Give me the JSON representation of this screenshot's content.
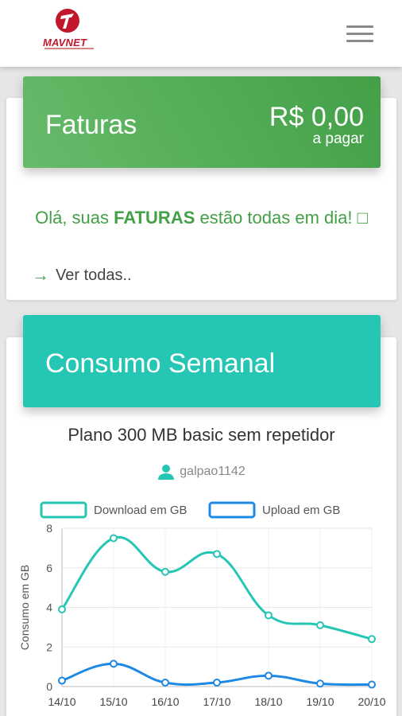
{
  "header": {
    "brand": "MAVNET",
    "menu_icon": "hamburger-menu-icon"
  },
  "invoices": {
    "title": "Faturas",
    "amount": "R$ 0,00",
    "amount_caption": "a pagar",
    "message_prefix": "Olá, suas ",
    "message_strong": "FATURAS",
    "message_suffix": " estão todas em dia! □",
    "view_all": "Ver todas..",
    "accent": "#43a047"
  },
  "usage": {
    "title": "Consumo Semanal",
    "plan": "Plano 300 MB basic sem repetidor",
    "username": "galpao1142",
    "accent": "#26c6b4"
  },
  "chart_data": {
    "type": "line",
    "categories": [
      "14/10",
      "15/10",
      "16/10",
      "17/10",
      "18/10",
      "19/10",
      "20/10"
    ],
    "ylabel": "Consumo em GB",
    "xlabel": "",
    "ylim": [
      0,
      8
    ],
    "yticks": [
      "0",
      "2",
      "4",
      "6",
      "8"
    ],
    "legend_position": "top",
    "grid": true,
    "series": [
      {
        "name": "Download em GB",
        "color": "#26c6b4",
        "values": [
          3.9,
          7.5,
          5.8,
          6.7,
          3.6,
          3.1,
          2.4
        ]
      },
      {
        "name": "Upload em GB",
        "color": "#1e88e5",
        "values": [
          0.3,
          1.15,
          0.2,
          0.2,
          0.55,
          0.15,
          0.1
        ]
      }
    ]
  }
}
